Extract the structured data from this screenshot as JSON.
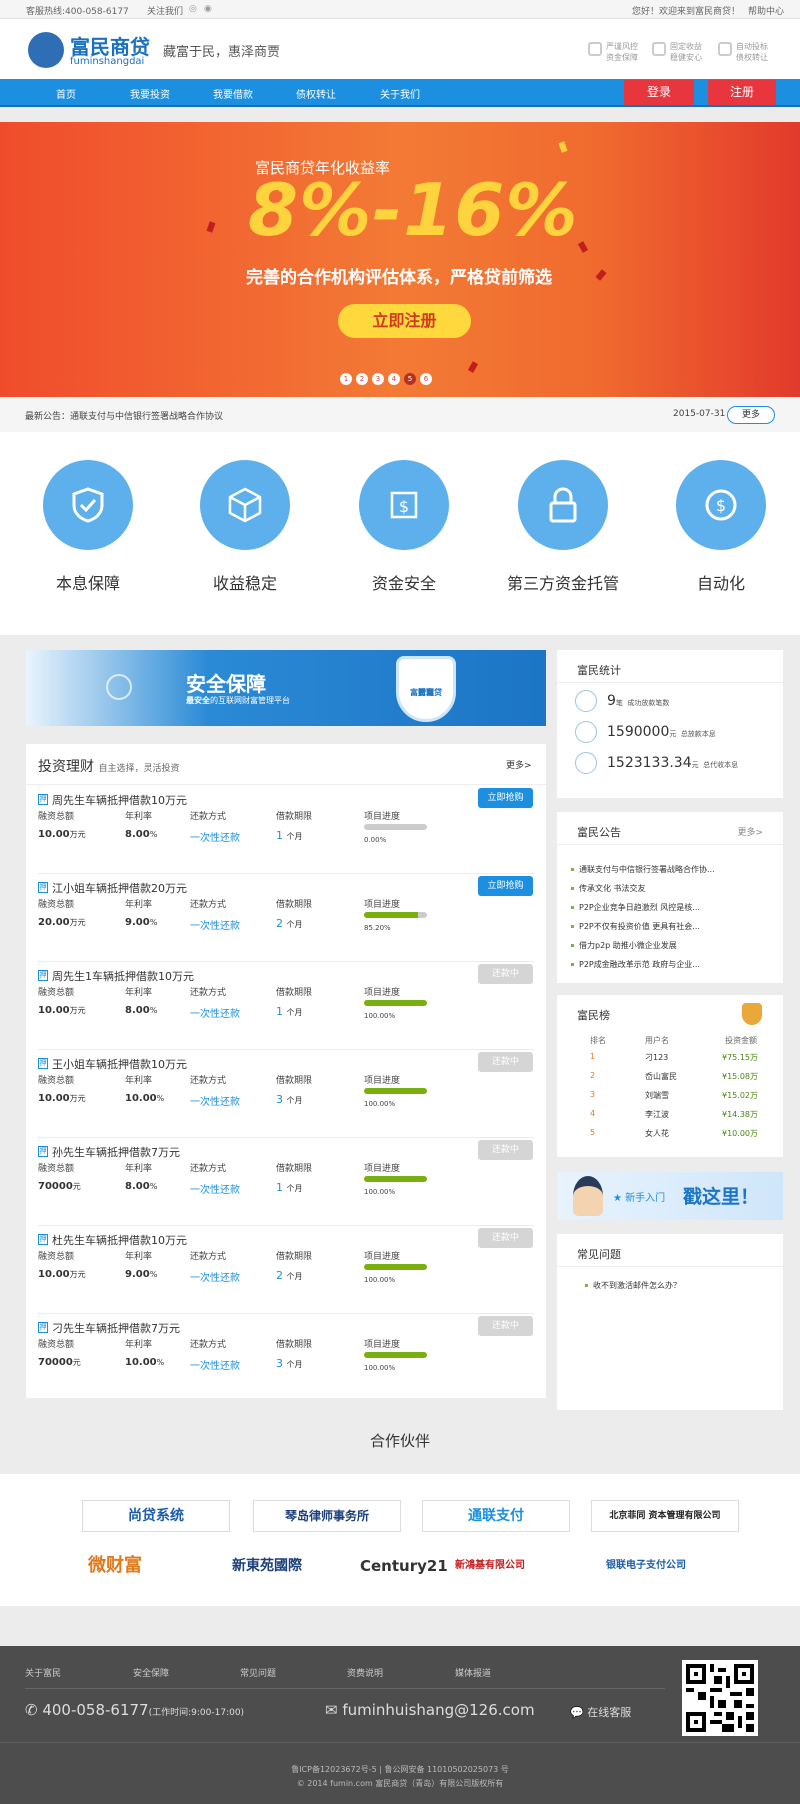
{
  "topbar": {
    "hotline": "客服热线:400-058-6177",
    "follow": "关注我们",
    "welcome": "您好！欢迎来到富民商贷！",
    "help": "帮助中心"
  },
  "header": {
    "brand": "富民商贷",
    "brand_pinyin": "fuminshangdai",
    "slogan": "藏富于民，惠泽商贾",
    "features": [
      {
        "l1": "严谨风控",
        "l2": "资金保障"
      },
      {
        "l1": "固定收益",
        "l2": "稳健安心"
      },
      {
        "l1": "自动投标",
        "l2": "债权转让"
      }
    ]
  },
  "nav": {
    "items": [
      "首页",
      "我要投资",
      "我要借款",
      "债权转让",
      "关于我们"
    ],
    "login": "登录",
    "register": "注册"
  },
  "banner": {
    "subtitle": "富民商贷年化收益率",
    "rate": "8%-16%",
    "desc": "完善的合作机构评估体系，严格贷前筛选",
    "cta": "立即注册",
    "pages": [
      "1",
      "2",
      "3",
      "4",
      "5",
      "6"
    ],
    "active_page": 5
  },
  "notice": {
    "text": "最新公告：通联支付与中信银行签署战略合作协议",
    "date": "2015-07-31",
    "more": "更多"
  },
  "features": [
    "本息保障",
    "收益稳定",
    "资金安全",
    "第三方资金托管",
    "自动化"
  ],
  "promo": {
    "title": "安全保障",
    "subtitle_bold": "最安全",
    "subtitle_rest": "的互联网财富管理平台",
    "shield_l1": "富民商贷",
    "shield_l2": "财富",
    "shield_l3": "管理"
  },
  "invest": {
    "title": "投资理财",
    "subtitle": "自主选择，灵活投资",
    "more": "更多>",
    "headers": {
      "amount": "融资总额",
      "rate": "年利率",
      "repay": "还款方式",
      "term": "借款期限",
      "progress": "项目进度"
    },
    "tag": "押",
    "loans": [
      {
        "name": "周先生车辆抵押借款10万元",
        "amount": "10.00",
        "amount_unit": "万元",
        "rate": "8.00",
        "rate_unit": "%",
        "repay": "一次性还款",
        "term": "1",
        "term_unit": "个月",
        "progress": 0,
        "progress_text": "0.00%",
        "action": "立即抢购",
        "active": true
      },
      {
        "name": "江小姐车辆抵押借款20万元",
        "amount": "20.00",
        "amount_unit": "万元",
        "rate": "9.00",
        "rate_unit": "%",
        "repay": "一次性还款",
        "term": "2",
        "term_unit": "个月",
        "progress": 0.852,
        "progress_text": "85.20%",
        "action": "立即抢购",
        "active": true
      },
      {
        "name": "周先生1车辆抵押借款10万元",
        "amount": "10.00",
        "amount_unit": "万元",
        "rate": "8.00",
        "rate_unit": "%",
        "repay": "一次性还款",
        "term": "1",
        "term_unit": "个月",
        "progress": 1,
        "progress_text": "100.00%",
        "action": "还款中",
        "active": false
      },
      {
        "name": "王小姐车辆抵押借款10万元",
        "amount": "10.00",
        "amount_unit": "万元",
        "rate": "10.00",
        "rate_unit": "%",
        "repay": "一次性还款",
        "term": "3",
        "term_unit": "个月",
        "progress": 1,
        "progress_text": "100.00%",
        "action": "还款中",
        "active": false
      },
      {
        "name": "孙先生车辆抵押借款7万元",
        "amount": "70000",
        "amount_unit": "元",
        "rate": "8.00",
        "rate_unit": "%",
        "repay": "一次性还款",
        "term": "1",
        "term_unit": "个月",
        "progress": 1,
        "progress_text": "100.00%",
        "action": "还款中",
        "active": false
      },
      {
        "name": "杜先生车辆抵押借款10万元",
        "amount": "10.00",
        "amount_unit": "万元",
        "rate": "9.00",
        "rate_unit": "%",
        "repay": "一次性还款",
        "term": "2",
        "term_unit": "个月",
        "progress": 1,
        "progress_text": "100.00%",
        "action": "还款中",
        "active": false
      },
      {
        "name": "刁先生车辆抵押借款7万元",
        "amount": "70000",
        "amount_unit": "元",
        "rate": "10.00",
        "rate_unit": "%",
        "repay": "一次性还款",
        "term": "3",
        "term_unit": "个月",
        "progress": 1,
        "progress_text": "100.00%",
        "action": "还款中",
        "active": false
      }
    ]
  },
  "stats": {
    "title": "富民统计",
    "items": [
      {
        "value": "9",
        "unit": "笔",
        "label": "成功放款笔数"
      },
      {
        "value": "1590000",
        "unit": "元",
        "label": "总放款本息"
      },
      {
        "value": "1523133.34",
        "unit": "元",
        "label": "总代收本息"
      }
    ]
  },
  "announcements": {
    "title": "富民公告",
    "more": "更多>",
    "items": [
      "通联支付与中信银行签署战略合作协...",
      "传承文化 书法交友",
      "P2P企业竞争日趋激烈 风控是核...",
      "P2P不仅有投资价值 更具有社会...",
      "借力p2p 助推小微企业发展",
      "P2P成金融改革示范 政府与企业..."
    ]
  },
  "ranking": {
    "title": "富民榜",
    "headers": [
      "排名",
      "用户名",
      "投资金额"
    ],
    "rows": [
      {
        "rank": "1",
        "user": "刁123",
        "amount": "¥75.15万"
      },
      {
        "rank": "2",
        "user": "岙山富民",
        "amount": "¥15.08万"
      },
      {
        "rank": "3",
        "user": "刘端雪",
        "amount": "¥15.02万"
      },
      {
        "rank": "4",
        "user": "李江波",
        "amount": "¥14.38万"
      },
      {
        "rank": "5",
        "user": "女人花",
        "amount": "¥10.00万"
      }
    ]
  },
  "newbie": {
    "small": "新手入门",
    "big": "戳这里！"
  },
  "faq": {
    "title": "常见问题",
    "items": [
      "收不到激活邮件怎么办？"
    ]
  },
  "partners": {
    "title": "合作伙伴",
    "row1": [
      "尚贷系统",
      "琴岛律师事务所",
      "通联支付",
      "北京菲同 资本管理有限公司"
    ],
    "row2": [
      "微财富",
      "新東苑國際",
      "Century21",
      "新鴻基有限公司",
      "银联电子支付公司"
    ]
  },
  "footer": {
    "links": [
      "关于富民",
      "安全保障",
      "常见问题",
      "资费说明",
      "媒体报道"
    ],
    "phone": "400-058-6177",
    "hours": "(工作时间:9:00-17:00)",
    "email": "fuminhuishang@126.com",
    "service": "在线客服",
    "icp": "鲁ICP备12023672号-5 | 鲁公网安备 11010502025073 号",
    "copyright": "© 2014 fumin.com 富民商贷（青岛）有限公司版权所有"
  },
  "colors": {
    "primary": "#1c8fe0",
    "danger": "#e8363e",
    "accent": "#ffd33d",
    "progress": "#78b10f"
  }
}
